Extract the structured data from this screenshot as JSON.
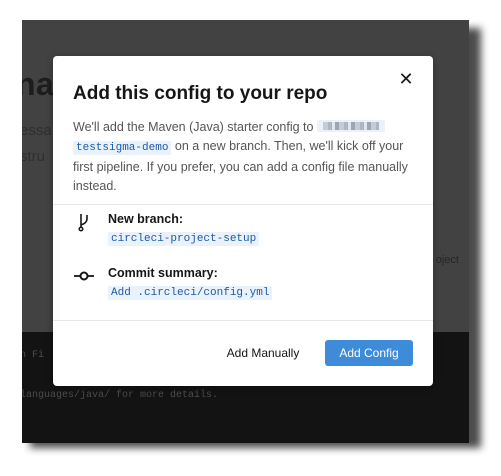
{
  "background": {
    "heading": "na",
    "line1": "essa",
    "line2": "stru",
    "right_text": "oject",
    "code_line1": "n Fi",
    "code_line2": "languages/java/ for more details."
  },
  "modal": {
    "close_glyph": "✕",
    "title": "Add this config to your repo",
    "desc_before": "We'll add the Maven (Java) starter config to ",
    "repo": "testsigma-demo",
    "desc_after": " on a new branch. Then, we'll kick off your first pipeline. If you prefer, you can add a config file manually instead.",
    "branch_label": "New branch:",
    "branch_value": "circleci-project-setup",
    "commit_label": "Commit summary:",
    "commit_value": "Add .circleci/config.yml",
    "manual_button": "Add Manually",
    "add_button": "Add Config"
  },
  "icons": {
    "branch": "git-branch-icon",
    "commit": "git-commit-icon",
    "close": "close-icon"
  },
  "colors": {
    "accent": "#3d8bd9",
    "code_bg": "#e9f2fb",
    "code_text": "#1e5aa8"
  }
}
